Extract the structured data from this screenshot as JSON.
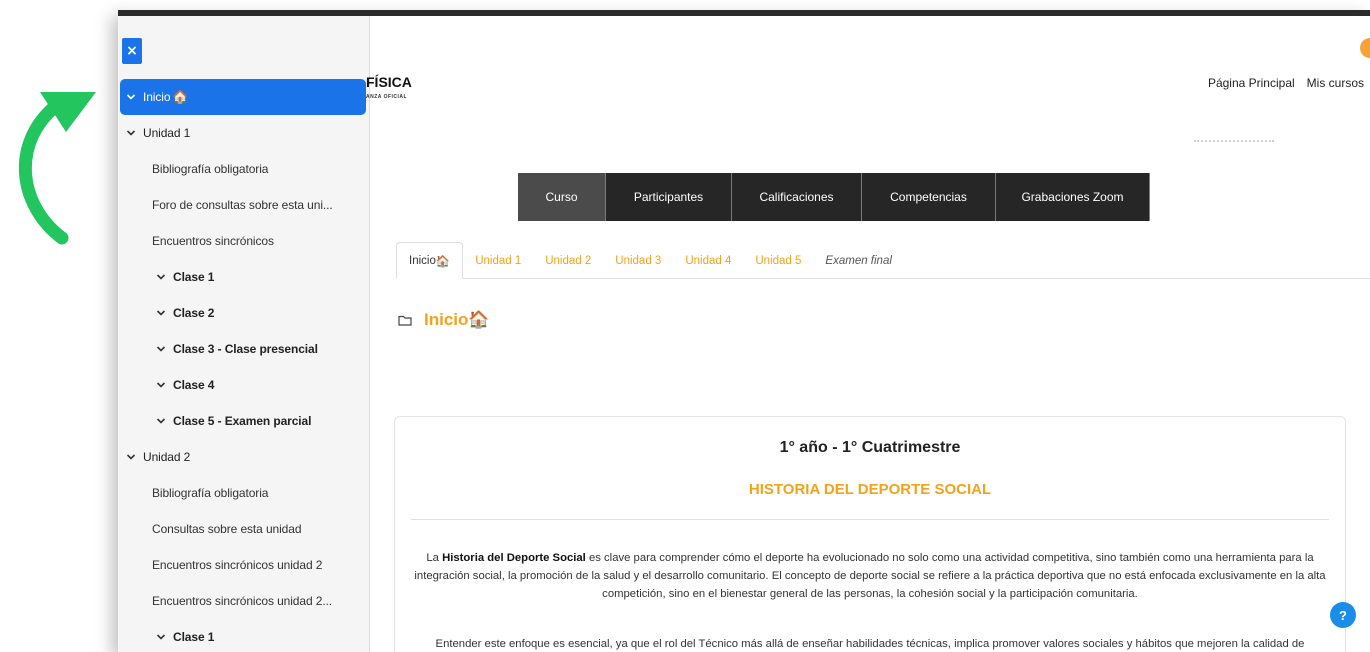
{
  "drawer": {
    "close_glyph": "×",
    "items": [
      {
        "label": "Inicio",
        "emoji": "🏠",
        "level": 0,
        "chevron": true,
        "active": true
      },
      {
        "label": "Unidad 1",
        "emoji": "",
        "level": 0,
        "chevron": true,
        "active": false
      },
      {
        "label": "Bibliografía obligatoria",
        "emoji": "",
        "level": 1,
        "chevron": false,
        "active": false
      },
      {
        "label": "Foro de consultas sobre esta uni...",
        "emoji": "",
        "level": 1,
        "chevron": false,
        "active": false
      },
      {
        "label": "Encuentros sincrónicos",
        "emoji": "",
        "level": 1,
        "chevron": false,
        "active": false
      },
      {
        "label": "Clase 1",
        "emoji": "",
        "level": 2,
        "chevron": true,
        "active": false
      },
      {
        "label": "Clase 2",
        "emoji": "",
        "level": 2,
        "chevron": true,
        "active": false
      },
      {
        "label": "Clase 3 - Clase presencial",
        "emoji": "",
        "level": 2,
        "chevron": true,
        "active": false
      },
      {
        "label": "Clase 4",
        "emoji": "",
        "level": 2,
        "chevron": true,
        "active": false
      },
      {
        "label": "Clase 5 - Examen parcial",
        "emoji": "",
        "level": 2,
        "chevron": true,
        "active": false
      },
      {
        "label": "Unidad 2",
        "emoji": "",
        "level": 0,
        "chevron": true,
        "active": false
      },
      {
        "label": "Bibliografía obligatoria",
        "emoji": "",
        "level": 1,
        "chevron": false,
        "active": false
      },
      {
        "label": "Consultas sobre esta unidad",
        "emoji": "",
        "level": 1,
        "chevron": false,
        "active": false
      },
      {
        "label": "Encuentros sincrónicos unidad 2",
        "emoji": "",
        "level": 1,
        "chevron": false,
        "active": false
      },
      {
        "label": "Encuentros sincrónicos unidad 2...",
        "emoji": "",
        "level": 1,
        "chevron": false,
        "active": false
      },
      {
        "label": "Clase 1",
        "emoji": "",
        "level": 2,
        "chevron": true,
        "active": false
      }
    ]
  },
  "header": {
    "brand_title": "FÍSICA",
    "brand_subtitle": "ANZA OFICIAL",
    "nav": [
      "Página Principal",
      "Mis cursos"
    ]
  },
  "course_menu": [
    {
      "label": "Curso",
      "active": true
    },
    {
      "label": "Participantes",
      "active": false
    },
    {
      "label": "Calificaciones",
      "active": false
    },
    {
      "label": "Competencias",
      "active": false
    },
    {
      "label": "Grabaciones Zoom",
      "active": false
    }
  ],
  "tabs": [
    {
      "label": "Inicio",
      "emoji": "🏠",
      "active": true,
      "italic": false
    },
    {
      "label": "Unidad 1",
      "emoji": "",
      "active": false,
      "italic": false
    },
    {
      "label": "Unidad 2",
      "emoji": "",
      "active": false,
      "italic": false
    },
    {
      "label": "Unidad 3",
      "emoji": "",
      "active": false,
      "italic": false
    },
    {
      "label": "Unidad 4",
      "emoji": "",
      "active": false,
      "italic": false
    },
    {
      "label": "Unidad 5",
      "emoji": "",
      "active": false,
      "italic": false
    },
    {
      "label": "Examen final",
      "emoji": "",
      "active": false,
      "italic": true
    }
  ],
  "section": {
    "title": "Inicio",
    "emoji": "🏠"
  },
  "card": {
    "heading": "1° año - 1° Cuatrimestre",
    "subheading": "HISTORIA DEL DEPORTE SOCIAL",
    "p1_pre": "La ",
    "p1_bold": "Historia del Deporte Social",
    "p1_post": " es clave para comprender cómo el deporte ha evolucionado no solo como una actividad competitiva, sino también como una herramienta para la integración social, la promoción de la salud y el desarrollo comunitario. El concepto de deporte social se refiere a la práctica deportiva que no está enfocada exclusivamente en la alta competición, sino en el bienestar general de las personas, la cohesión social y la participación comunitaria.",
    "p2": "Entender este enfoque es esencial, ya que el rol del Técnico más allá de enseñar habilidades técnicas, implica promover valores sociales y hábitos que mejoren la calidad de"
  },
  "help_label": "?",
  "colors": {
    "accent": "#1a73e8",
    "orange": "#f2a31a",
    "menu_dark": "#262626",
    "arrow_green": "#22c55e"
  }
}
